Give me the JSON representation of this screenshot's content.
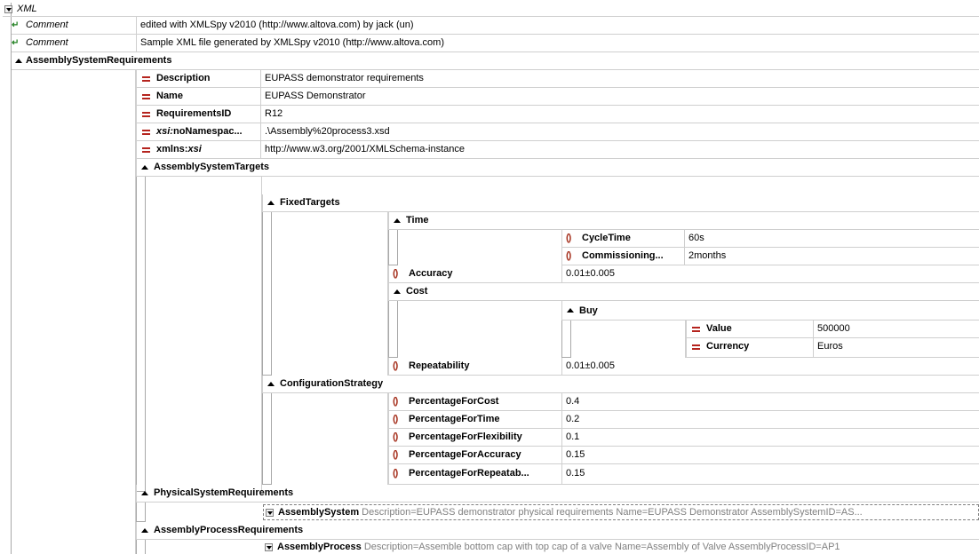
{
  "xml_label": "XML",
  "comment_label": "Comment",
  "comments": [
    "edited with XMLSpy v2010 (http://www.altova.com) by jack (un)",
    "Sample XML file generated by XMLSpy v2010 (http://www.altova.com)"
  ],
  "root": {
    "name": "AssemblySystemRequirements",
    "attributes": [
      {
        "name": "Description",
        "value": "EUPASS demonstrator requirements"
      },
      {
        "name": "Name",
        "value": "EUPASS Demonstrator"
      },
      {
        "name": "RequirementsID",
        "value": "R12"
      },
      {
        "name_prefix": "xsi:",
        "name_rest": "noNamespac...",
        "value": ".\\Assembly%20process3.xsd"
      },
      {
        "name_prefix": "xmlns:",
        "name_rest": "xsi",
        "value": "http://www.w3.org/2001/XMLSchema-instance"
      }
    ]
  },
  "targets": {
    "name": "AssemblySystemTargets",
    "fixed": "FixedTargets",
    "time": "Time",
    "cycle_time": {
      "name": "CycleTime",
      "value": "60s"
    },
    "commissioning": {
      "name": "Commissioning...",
      "value": "2months"
    },
    "accuracy": {
      "name": "Accuracy",
      "value": "0.01±0.005"
    },
    "cost": "Cost",
    "buy": "Buy",
    "value": {
      "name": "Value",
      "value": "500000"
    },
    "currency": {
      "name": "Currency",
      "value": "Euros"
    },
    "repeatability": {
      "name": "Repeatability",
      "value": "0.01±0.005"
    }
  },
  "strategy": {
    "name": "ConfigurationStrategy",
    "items": [
      {
        "name": "PercentageForCost",
        "value": "0.4"
      },
      {
        "name": "PercentageForTime",
        "value": "0.2"
      },
      {
        "name": "PercentageForFlexibility",
        "value": "0.1"
      },
      {
        "name": "PercentageForAccuracy",
        "value": "0.15"
      },
      {
        "name": "PercentageForRepeatab...",
        "value": "0.15"
      }
    ]
  },
  "physical": {
    "name": "PhysicalSystemRequirements",
    "child": "AssemblySystem",
    "child_attrs": "Description=EUPASS demonstrator physical requirements Name=EUPASS Demonstrator AssemblySystemID=AS..."
  },
  "process": {
    "name": "AssemblyProcessRequirements",
    "child": "AssemblyProcess",
    "child_attrs": "Description=Assemble bottom cap with top cap of a valve Name=Assembly of Valve AssemblyProcessID=AP1"
  }
}
